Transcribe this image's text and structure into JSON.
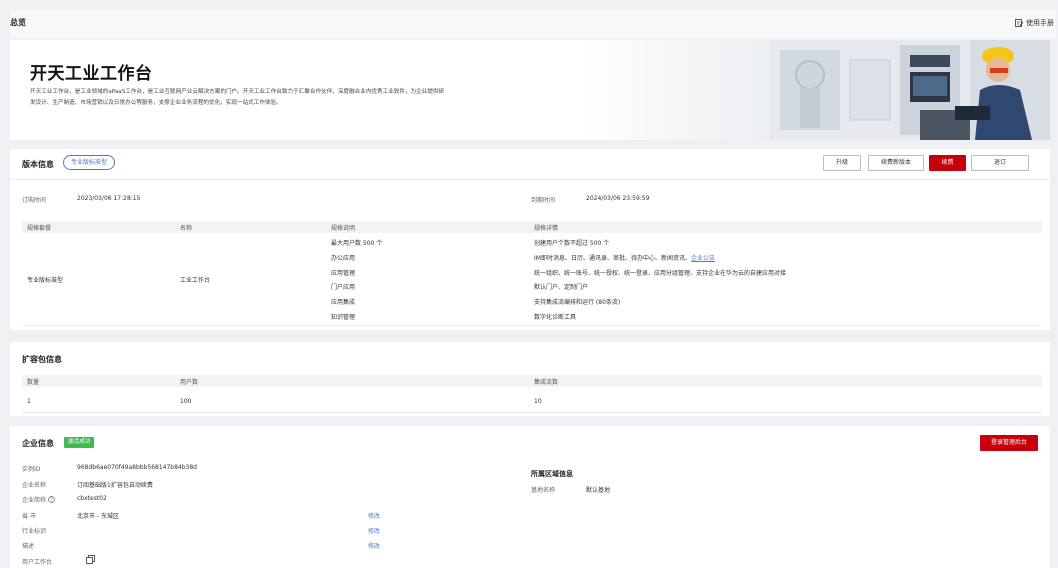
{
  "header": {
    "title": "总览",
    "manual_label": "使用手册"
  },
  "banner": {
    "title": "开天工业工作台",
    "desc_line1": "开天工业工作台，是工业领域的aPaaS工作台，是工业互联网产业云解决方案的门户。开天工业工作台致力于汇聚合作伙伴，深度融合业内优秀工业软件，为企业提供研",
    "desc_line2": "发设计、生产制造、市场营销以及日常办公等服务，支撑企业业务流程的优化，实现一站式工作体验。"
  },
  "version": {
    "title": "版本信息",
    "tag": "专业版标准型",
    "buttons": {
      "upgrade": "升级",
      "renew_new": "续费新版本",
      "renew": "续费",
      "unsubscribe": "退订"
    },
    "order_time_label": "订购时间",
    "order_time": "2023/03/06 17:28:15",
    "expire_label": "到期时间",
    "expire_time": "2024/03/06 23:59:59",
    "table": {
      "headers": [
        "规格套餐",
        "名称",
        "规格说明",
        "规格详情"
      ],
      "package": "专业版标准型",
      "name": "工业工作台",
      "rows": [
        {
          "spec": "最大用户数 500 个",
          "detail": "创建用户个数不超过 500 个"
        },
        {
          "spec": "办公应用",
          "detail": "IM即时消息、日历、通讯录、审批、待办中心、新闻资讯、",
          "detail_link": "企业公告"
        },
        {
          "spec": "应用管理",
          "detail": "统一组织、统一账号、统一授权、统一登录、应用分组管理、支持企业在华为云的自建应用对接"
        },
        {
          "spec": "门户应用",
          "detail": "默认门户、定制门户"
        },
        {
          "spec": "应用集成",
          "detail": "支持集成流编排和运行 (80条流)"
        },
        {
          "spec": "知识管理",
          "detail": "数字化诊断工具"
        }
      ]
    }
  },
  "ext": {
    "title": "扩容包信息",
    "headers": [
      "数量",
      "用户数",
      "集成流数"
    ],
    "row": [
      "1",
      "100",
      "10"
    ]
  },
  "enterprise": {
    "title": "企业信息",
    "badge": "激活成功",
    "login_button": "登录管理后台",
    "fields": [
      {
        "label": "实例ID",
        "value": "968db6ae070f49a8bbb568147b84b38d"
      },
      {
        "label": "企业名称",
        "value": "订阅基础版1扩容包自动续费"
      },
      {
        "label": "企业简称",
        "value": "cbxtest02"
      },
      {
        "label": "省-市",
        "value": "北京市 - 东城区",
        "edit": "修改"
      },
      {
        "label": "行业标识",
        "value": "",
        "edit": "修改"
      },
      {
        "label": "描述",
        "value": "",
        "edit": "修改"
      },
      {
        "label": "用户工作台",
        "value": ""
      }
    ],
    "region_title": "所属区域信息",
    "region_label": "基地名称",
    "region_value": "默认基地"
  }
}
